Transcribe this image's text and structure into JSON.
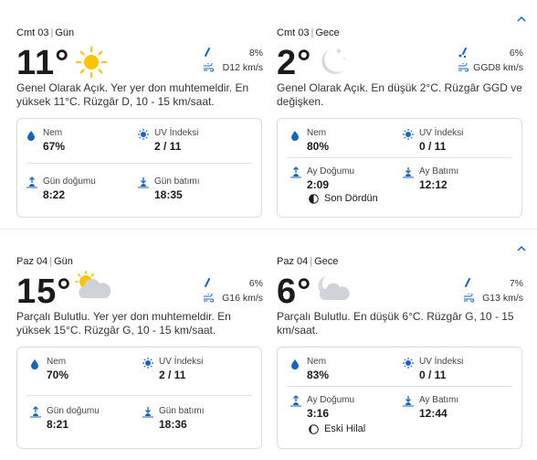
{
  "days": [
    {
      "day_panel": {
        "date": "Cmt 03",
        "period": "Gün",
        "temp": "11°",
        "precip": "8%",
        "wind": "D12 km/s",
        "summary": "Genel Olarak Açık. Yer yer don muhtemeldir. En yüksek 11°C. Rüzgâr D, 10 - 15 km/saat.",
        "icon": "sun-icon",
        "humidity_label": "Nem",
        "humidity": "67%",
        "uv_label": "UV İndeksi",
        "uv": "2 / 11",
        "rise_label": "Gün doğumu",
        "rise": "8:22",
        "set_label": "Gün batımı",
        "set": "18:35"
      },
      "night_panel": {
        "date": "Cmt 03",
        "period": "Gece",
        "temp": "2°",
        "precip": "6%",
        "wind": "GGD8 km/s",
        "summary": "Genel Olarak Açık. En düşük 2°C. Rüzgâr GGD ve değişken.",
        "icon": "moon-stars-icon",
        "humidity_label": "Nem",
        "humidity": "80%",
        "uv_label": "UV İndeksi",
        "uv": "0 / 11",
        "rise_label": "Ay Doğumu",
        "rise": "2:09",
        "set_label": "Ay Batımı",
        "set": "12:12",
        "moon_phase": "Son Dördün"
      }
    },
    {
      "day_panel": {
        "date": "Paz 04",
        "period": "Gün",
        "temp": "15°",
        "precip": "6%",
        "wind": "G16 km/s",
        "summary": "Parçalı Bulutlu. Yer yer don muhtemeldir. En yüksek 15°C. Rüzgâr G, 10 - 15 km/saat.",
        "icon": "partly-cloudy-day-icon",
        "humidity_label": "Nem",
        "humidity": "70%",
        "uv_label": "UV İndeksi",
        "uv": "2 / 11",
        "rise_label": "Gün doğumu",
        "rise": "8:21",
        "set_label": "Gün batımı",
        "set": "18:36"
      },
      "night_panel": {
        "date": "Paz 04",
        "period": "Gece",
        "temp": "6°",
        "precip": "7%",
        "wind": "G13 km/s",
        "summary": "Parçalı Bulutlu. En düşük 6°C. Rüzgâr G, 10 - 15 km/saat.",
        "icon": "partly-cloudy-night-icon",
        "humidity_label": "Nem",
        "humidity": "83%",
        "uv_label": "UV İndeksi",
        "uv": "0 / 11",
        "rise_label": "Ay Doğumu",
        "rise": "3:16",
        "set_label": "Ay Batımı",
        "set": "12:44",
        "moon_phase": "Eski Hilal"
      }
    }
  ],
  "colors": {
    "accent": "#1565c0",
    "sun": "#f7c600",
    "moon": "#d9d9de",
    "cloud": "#cfd3d8"
  }
}
